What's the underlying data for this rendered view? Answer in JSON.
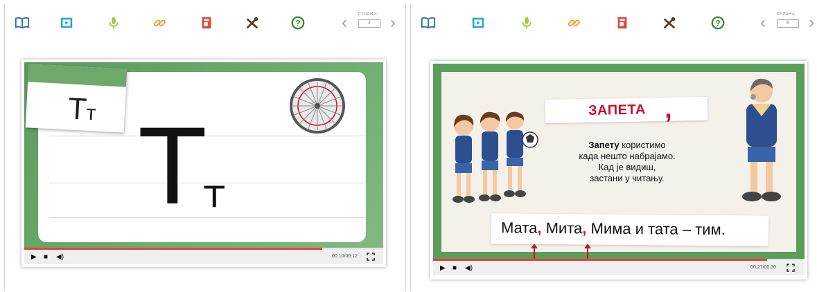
{
  "left": {
    "pager": {
      "label": "СТРАНА:",
      "value": "2"
    },
    "player": {
      "time": "00:10/00:12",
      "progress": 0.83,
      "note_letter_upper": "Т",
      "note_letter_lower": "т",
      "big_upper": "Т",
      "big_lower": "т"
    }
  },
  "right": {
    "pager": {
      "label": "СТРАНА:",
      "value": "6"
    },
    "player": {
      "time": "00:27/00:30",
      "progress": 0.9,
      "title": "ЗАПЕТА",
      "title_mark": ",",
      "rule_bold": "Запету",
      "rule_rest": " користимо",
      "rule_line2": "када нешто набрајамо.",
      "rule_line3": "Кад је видиш,",
      "rule_line4": "застани у читању.",
      "sentence_part1": "Мата",
      "comma1": ",",
      "sentence_part2": " Мита",
      "comma2": ",",
      "sentence_part3": " Мима и тата – тим."
    }
  },
  "icons": [
    "book-icon",
    "video-icon",
    "microphone-icon",
    "link-icon",
    "document-icon",
    "tools-icon",
    "help-icon"
  ],
  "colors": {
    "book": "#2b6cb0",
    "video": "#2aa8d8",
    "mic": "#9ccc3c",
    "link": "#f0a030",
    "doc": "#e2483d",
    "tools": "#5a3a1e",
    "help": "#2e8b2e",
    "progress": "#e8403a"
  }
}
